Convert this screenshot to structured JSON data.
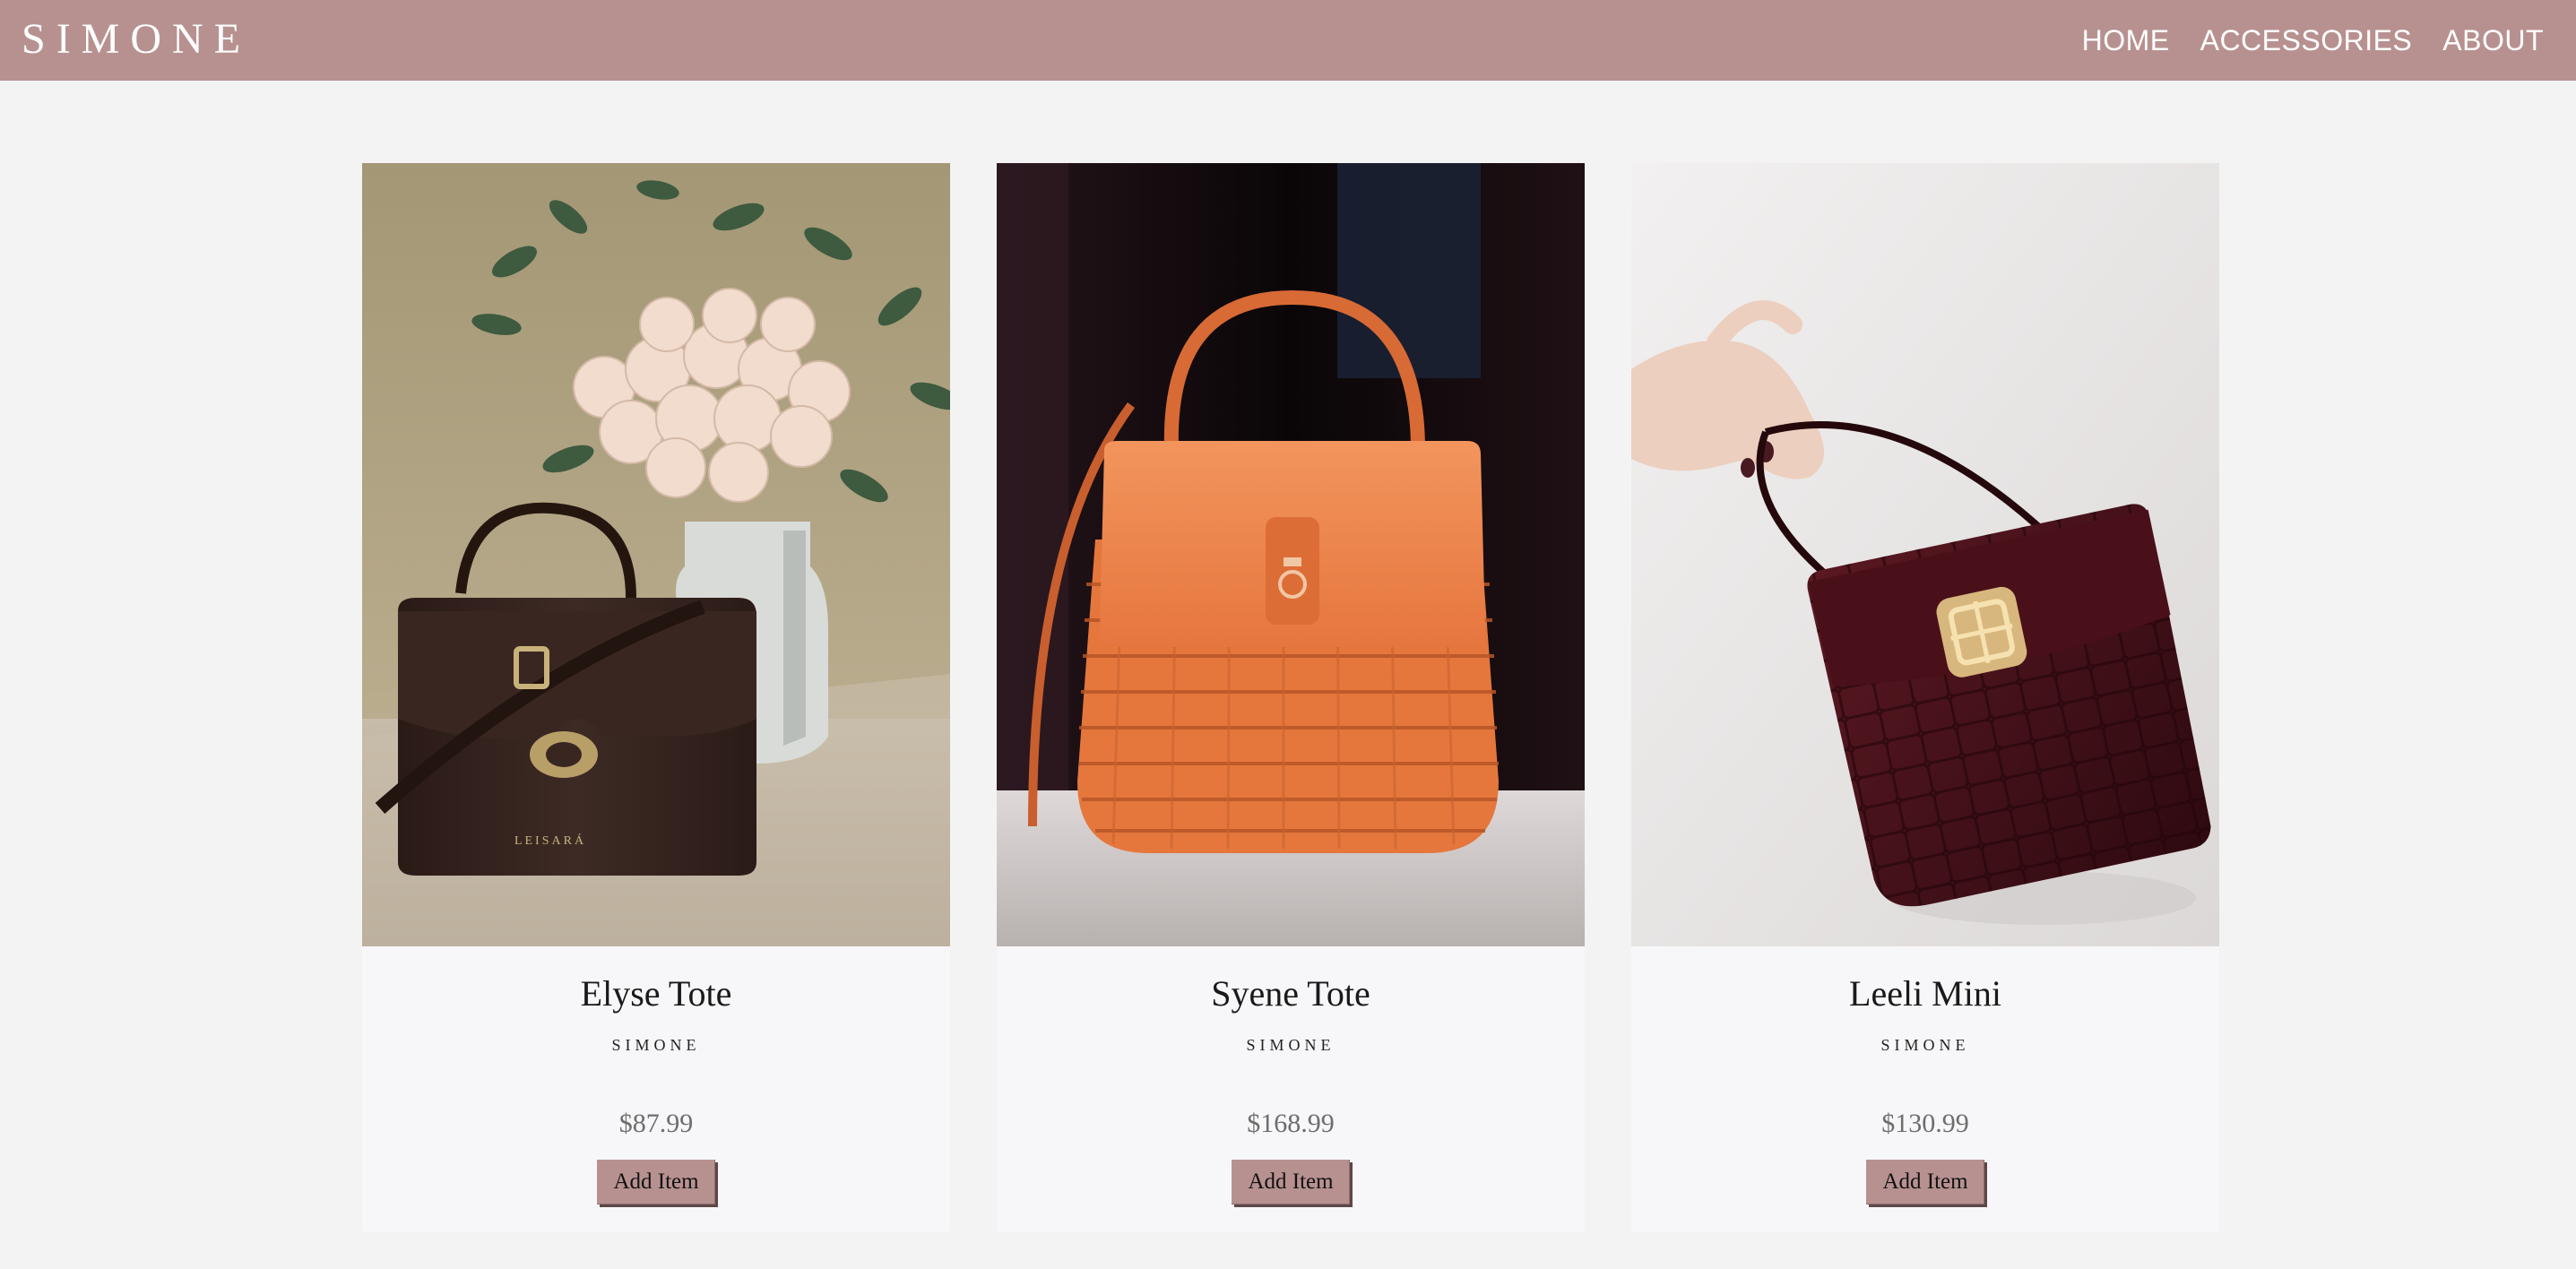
{
  "header": {
    "logo": "SIMONE",
    "nav": [
      "HOME",
      "ACCESSORIES",
      "ABOUT"
    ],
    "bar_color": "#b79190"
  },
  "products": [
    {
      "name": "Elyse Tote",
      "brand": "SIMONE",
      "price": "$87.99",
      "button": "Add Item",
      "bag_stamp": "LEISARÁ"
    },
    {
      "name": "Syene Tote",
      "brand": "SIMONE",
      "price": "$168.99",
      "button": "Add Item"
    },
    {
      "name": "Leeli Mini",
      "brand": "SIMONE",
      "price": "$130.99",
      "button": "Add Item"
    }
  ]
}
